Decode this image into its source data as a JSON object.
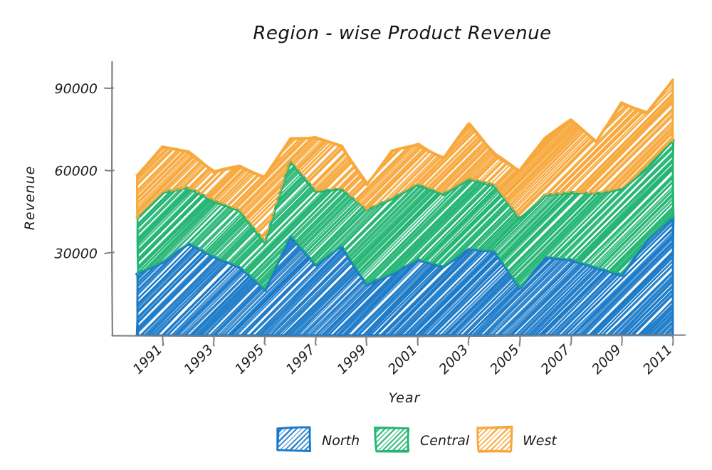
{
  "chart_data": {
    "type": "area",
    "stacked": true,
    "title": "Region - wise Product Revenue",
    "xlabel": "Year",
    "ylabel": "Revenue",
    "grid": false,
    "legend_position": "bottom",
    "style": "hand-drawn-sketch",
    "x": [
      1990,
      1991,
      1992,
      1993,
      1994,
      1995,
      1996,
      1997,
      1998,
      1999,
      2000,
      2001,
      2002,
      2003,
      2004,
      2005,
      2006,
      2007,
      2008,
      2009,
      2010,
      2011
    ],
    "xtick_labels": [
      "1991",
      "1993",
      "1995",
      "1997",
      "1999",
      "2001",
      "2003",
      "2005",
      "2007",
      "2009",
      "2011"
    ],
    "xtick_values": [
      1991,
      1993,
      1995,
      1997,
      1999,
      2001,
      2003,
      2005,
      2007,
      2009,
      2011
    ],
    "ytick_labels": [
      "30000",
      "60000",
      "90000"
    ],
    "ytick_values": [
      30000,
      60000,
      90000
    ],
    "xlim": [
      1990,
      2011
    ],
    "ylim": [
      0,
      99000
    ],
    "series": [
      {
        "name": "North",
        "color": "#1b7ac8",
        "values": [
          22500,
          26500,
          33500,
          28500,
          25000,
          16500,
          36000,
          25500,
          32500,
          18500,
          22500,
          27500,
          25000,
          31500,
          30500,
          17000,
          28500,
          27500,
          24500,
          22000,
          35000,
          43000
        ]
      },
      {
        "name": "Central",
        "color": "#23b573",
        "values": [
          20500,
          25500,
          20000,
          20500,
          20500,
          17500,
          27500,
          27000,
          21000,
          27000,
          27500,
          27500,
          26500,
          25500,
          24000,
          25500,
          22500,
          24500,
          27000,
          31500,
          26000,
          28000
        ]
      },
      {
        "name": "West",
        "color": "#f7a83c",
        "values": [
          15000,
          16500,
          13500,
          10500,
          16000,
          23500,
          8000,
          19500,
          15500,
          9500,
          17500,
          14500,
          13000,
          20000,
          11500,
          17500,
          21000,
          26500,
          19000,
          31000,
          20000,
          22000
        ]
      }
    ],
    "stacked_tops": {
      "North": [
        22500,
        26500,
        33500,
        28500,
        25000,
        16500,
        36000,
        25500,
        32500,
        18500,
        22500,
        27500,
        25000,
        31500,
        30500,
        17000,
        28500,
        27500,
        24500,
        22000,
        35000,
        43000
      ],
      "Central": [
        43000,
        52000,
        53500,
        49000,
        45500,
        34000,
        63500,
        52500,
        53500,
        45500,
        50000,
        55000,
        51500,
        57000,
        54500,
        42500,
        51000,
        52000,
        51500,
        53500,
        61000,
        71000
      ],
      "West": [
        58000,
        68500,
        67000,
        59500,
        61500,
        57500,
        71500,
        72000,
        69000,
        55000,
        67500,
        69500,
        64500,
        77000,
        66000,
        60000,
        72000,
        78500,
        70500,
        84500,
        81000,
        93000
      ]
    }
  },
  "legend": {
    "items": [
      {
        "label": "North",
        "color": "#1b7ac8"
      },
      {
        "label": "Central",
        "color": "#23b573"
      },
      {
        "label": "West",
        "color": "#f7a83c"
      }
    ]
  }
}
